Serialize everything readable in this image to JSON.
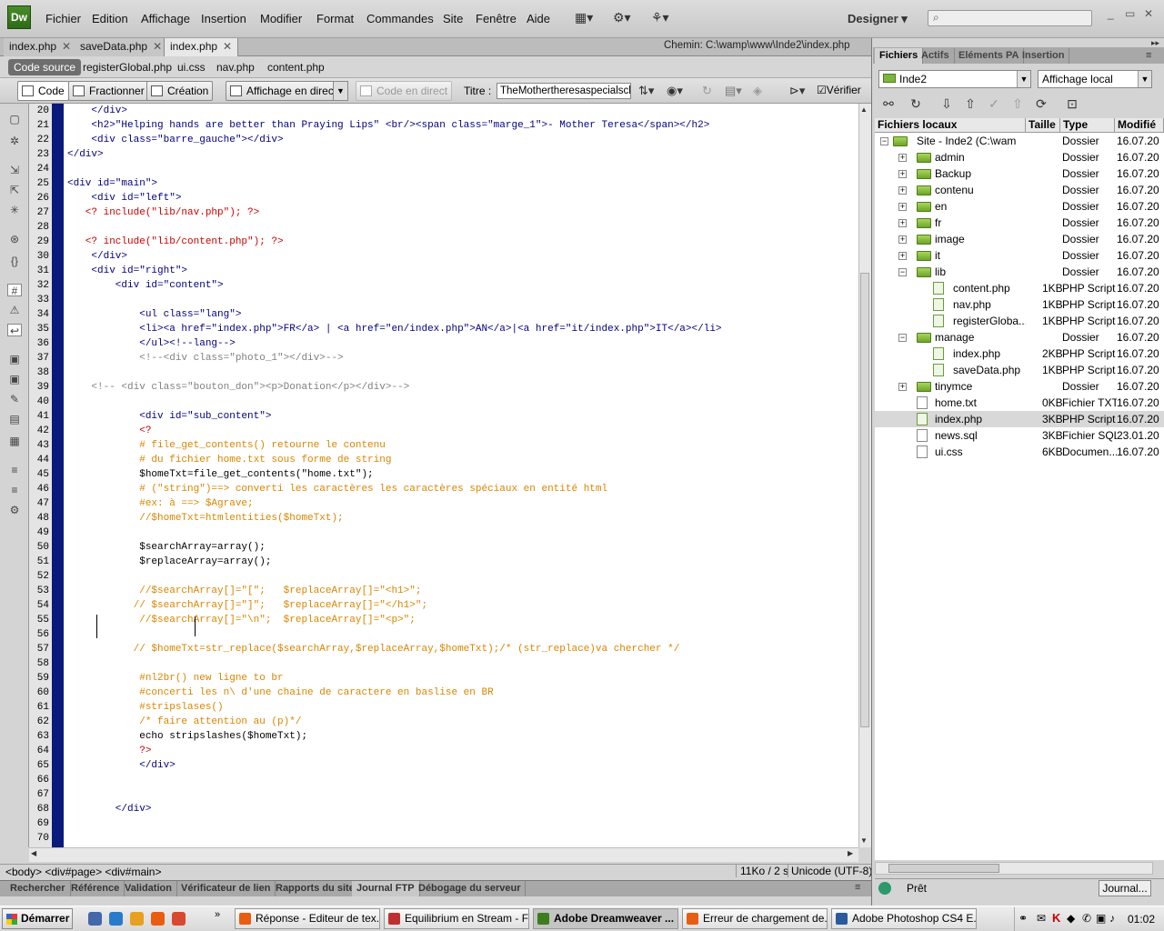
{
  "app": {
    "logo": "Dw",
    "menus": [
      "Fichier",
      "Edition",
      "Affichage",
      "Insertion",
      "Modifier",
      "Format",
      "Commandes",
      "Site",
      "Fenêtre",
      "Aide"
    ],
    "workspace": "Designer",
    "window_controls": [
      "_",
      "▭",
      "✕"
    ]
  },
  "tabs": [
    {
      "label": "index.php",
      "active": false
    },
    {
      "label": "saveData.php",
      "active": false
    },
    {
      "label": "index.php",
      "active": true
    }
  ],
  "chemin": "Chemin:  C:\\wamp\\www\\Inde2\\index.php",
  "related": {
    "current": "Code source",
    "files": [
      "registerGlobal.php",
      "ui.css",
      "nav.php",
      "content.php"
    ]
  },
  "doc_toolbar": {
    "code": "Code",
    "split": "Fractionner",
    "design": "Création",
    "live": "Affichage en direct",
    "live_code": "Code en direct",
    "titre_label": "Titre :",
    "titre_value": "TheMothertheresaspecialscho",
    "verify": "Vérifier"
  },
  "code": {
    "lines": [
      {
        "n": "20",
        "t": "    </div>",
        "c": "b"
      },
      {
        "n": "21",
        "t": "    <h2>\"Helping hands are better than Praying Lips\" <br/><span class=\"marge_1\">- Mother Teresa</span></h2>",
        "c": "b"
      },
      {
        "n": "22",
        "t": "    <div class=\"barre_gauche\"></div>",
        "c": "b"
      },
      {
        "n": "23",
        "t": "</div>",
        "c": "b"
      },
      {
        "n": "24",
        "t": "",
        "c": "b"
      },
      {
        "n": "25",
        "t": "<div id=\"main\">",
        "c": "b"
      },
      {
        "n": "26",
        "t": "    <div id=\"left\">",
        "c": "b"
      },
      {
        "n": "27",
        "t": "   <? include(\"lib/nav.php\"); ?>",
        "c": "r"
      },
      {
        "n": "28",
        "t": "",
        "c": "b"
      },
      {
        "n": "29",
        "t": "   <? include(\"lib/content.php\"); ?>",
        "c": "r"
      },
      {
        "n": "30",
        "t": "    </div>",
        "c": "b"
      },
      {
        "n": "31",
        "t": "    <div id=\"right\">",
        "c": "b"
      },
      {
        "n": "32",
        "t": "        <div id=\"content\">",
        "c": "b"
      },
      {
        "n": "33",
        "t": "",
        "c": "b"
      },
      {
        "n": "34",
        "t": "            <ul class=\"lang\">",
        "c": "b"
      },
      {
        "n": "35",
        "t": "            <li><a href=\"index.php\">FR</a> | <a href=\"en/index.php\">AN</a>|<a href=\"it/index.php\">IT</a></li>",
        "c": "b"
      },
      {
        "n": "36",
        "t": "            </ul><!--lang-->",
        "c": "b"
      },
      {
        "n": "37",
        "t": "            <!--<div class=\"photo_1\"></div>-->",
        "c": "g"
      },
      {
        "n": "38",
        "t": "",
        "c": "b"
      },
      {
        "n": "39",
        "t": "    <!-- <div class=\"bouton_don\"><p>Donation</p></div>-->",
        "c": "g"
      },
      {
        "n": "40",
        "t": "",
        "c": "b"
      },
      {
        "n": "41",
        "t": "            <div id=\"sub_content\">",
        "c": "b"
      },
      {
        "n": "42",
        "t": "            <?",
        "c": "r"
      },
      {
        "n": "43",
        "t": "            # file_get_contents() retourne le contenu",
        "c": "o"
      },
      {
        "n": "44",
        "t": "            # du fichier home.txt sous forme de string",
        "c": "o"
      },
      {
        "n": "45",
        "t": "            $homeTxt=file_get_contents(\"home.txt\");",
        "c": "k"
      },
      {
        "n": "46",
        "t": "            # (\"string\")==> converti les caractères les caractères spéciaux en entité html",
        "c": "o"
      },
      {
        "n": "47",
        "t": "            #ex: à ==> $Agrave;",
        "c": "o"
      },
      {
        "n": "48",
        "t": "            //$homeTxt=htmlentities($homeTxt);",
        "c": "o"
      },
      {
        "n": "49",
        "t": "",
        "c": "b"
      },
      {
        "n": "50",
        "t": "            $searchArray=array();",
        "c": "k"
      },
      {
        "n": "51",
        "t": "            $replaceArray=array();",
        "c": "k"
      },
      {
        "n": "52",
        "t": "",
        "c": "b"
      },
      {
        "n": "53",
        "t": "            //$searchArray[]=\"[\";   $replaceArray[]=\"<h1>\";",
        "c": "o"
      },
      {
        "n": "54",
        "t": "           // $searchArray[]=\"]\";   $replaceArray[]=\"</h1>\";",
        "c": "o"
      },
      {
        "n": "55",
        "t": "            //$searchArray[]=\"\\n\";  $replaceArray[]=\"<p>\";",
        "c": "o"
      },
      {
        "n": "56",
        "t": "",
        "c": "b"
      },
      {
        "n": "57",
        "t": "           // $homeTxt=str_replace($searchArray,$replaceArray,$homeTxt);/* (str_replace)va chercher */",
        "c": "o"
      },
      {
        "n": "58",
        "t": "",
        "c": "b"
      },
      {
        "n": "59",
        "t": "            #nl2br() new ligne to br",
        "c": "o"
      },
      {
        "n": "60",
        "t": "            #concerti les n\\ d'une chaine de caractere en baslise en BR",
        "c": "o"
      },
      {
        "n": "61",
        "t": "            #stripslases()",
        "c": "o"
      },
      {
        "n": "62",
        "t": "            /* faire attention au (p)*/",
        "c": "o"
      },
      {
        "n": "63",
        "t": "            echo stripslashes($homeTxt);",
        "c": "k"
      },
      {
        "n": "64",
        "t": "            ?>",
        "c": "r"
      },
      {
        "n": "65",
        "t": "            </div>",
        "c": "b"
      },
      {
        "n": "66",
        "t": "",
        "c": "b"
      },
      {
        "n": "67",
        "t": "",
        "c": "b"
      },
      {
        "n": "68",
        "t": "        </div>",
        "c": "b"
      },
      {
        "n": "69",
        "t": "",
        "c": "b"
      },
      {
        "n": "70",
        "t": "",
        "c": "b"
      }
    ]
  },
  "status": {
    "tag_selector": "<body> <div#page> <div#main>",
    "size": "11Ko / 2 s",
    "encoding": "Unicode (UTF-8)"
  },
  "bottom_tabs": [
    {
      "label": "Rechercher",
      "active": false
    },
    {
      "label": "Référence",
      "active": false
    },
    {
      "label": "Validation",
      "active": false
    },
    {
      "label": "Vérificateur de lien",
      "active": false
    },
    {
      "label": "Rapports du site",
      "active": false
    },
    {
      "label": "Journal FTP",
      "active": true
    },
    {
      "label": "Débogage du serveur",
      "active": false
    }
  ],
  "files_panel": {
    "tabs": [
      {
        "label": "Fichiers",
        "active": true
      },
      {
        "label": "Actifs",
        "active": false
      },
      {
        "label": "Eléments PA",
        "active": false
      },
      {
        "label": "Insertion",
        "active": false
      }
    ],
    "site": "Inde2",
    "view": "Affichage local",
    "headers": [
      "Fichiers locaux",
      "Taille",
      "Type",
      "Modifié"
    ],
    "rows": [
      {
        "name": "Site - Inde2 (C:\\wam...",
        "size": "",
        "type": "Dossier",
        "mod": "16.07.20",
        "kind": "folder",
        "level": 0,
        "exp": "−",
        "selected": false
      },
      {
        "name": "admin",
        "size": "",
        "type": "Dossier",
        "mod": "16.07.20",
        "kind": "folder",
        "level": 1,
        "exp": "+",
        "selected": false
      },
      {
        "name": "Backup",
        "size": "",
        "type": "Dossier",
        "mod": "16.07.20",
        "kind": "folder",
        "level": 1,
        "exp": "+",
        "selected": false
      },
      {
        "name": "contenu",
        "size": "",
        "type": "Dossier",
        "mod": "16.07.20",
        "kind": "folder",
        "level": 1,
        "exp": "+",
        "selected": false
      },
      {
        "name": "en",
        "size": "",
        "type": "Dossier",
        "mod": "16.07.20",
        "kind": "folder",
        "level": 1,
        "exp": "+",
        "selected": false
      },
      {
        "name": "fr",
        "size": "",
        "type": "Dossier",
        "mod": "16.07.20",
        "kind": "folder",
        "level": 1,
        "exp": "+",
        "selected": false
      },
      {
        "name": "image",
        "size": "",
        "type": "Dossier",
        "mod": "16.07.20",
        "kind": "folder",
        "level": 1,
        "exp": "+",
        "selected": false
      },
      {
        "name": "it",
        "size": "",
        "type": "Dossier",
        "mod": "16.07.20",
        "kind": "folder",
        "level": 1,
        "exp": "+",
        "selected": false
      },
      {
        "name": "lib",
        "size": "",
        "type": "Dossier",
        "mod": "16.07.20",
        "kind": "folder",
        "level": 1,
        "exp": "−",
        "selected": false
      },
      {
        "name": "content.php",
        "size": "1KB",
        "type": "PHP Script",
        "mod": "16.07.20",
        "kind": "php",
        "level": 2,
        "exp": "",
        "selected": false
      },
      {
        "name": "nav.php",
        "size": "1KB",
        "type": "PHP Script",
        "mod": "16.07.20",
        "kind": "php",
        "level": 2,
        "exp": "",
        "selected": false
      },
      {
        "name": "registerGloba...",
        "size": "1KB",
        "type": "PHP Script",
        "mod": "16.07.20",
        "kind": "php",
        "level": 2,
        "exp": "",
        "selected": false
      },
      {
        "name": "manage",
        "size": "",
        "type": "Dossier",
        "mod": "16.07.20",
        "kind": "folder",
        "level": 1,
        "exp": "−",
        "selected": false
      },
      {
        "name": "index.php",
        "size": "2KB",
        "type": "PHP Script",
        "mod": "16.07.20",
        "kind": "php",
        "level": 2,
        "exp": "",
        "selected": false
      },
      {
        "name": "saveData.php",
        "size": "1KB",
        "type": "PHP Script",
        "mod": "16.07.20",
        "kind": "php",
        "level": 2,
        "exp": "",
        "selected": false
      },
      {
        "name": "tinymce",
        "size": "",
        "type": "Dossier",
        "mod": "16.07.20",
        "kind": "folder",
        "level": 1,
        "exp": "+",
        "selected": false
      },
      {
        "name": "home.txt",
        "size": "0KB",
        "type": "Fichier TXT",
        "mod": "16.07.20",
        "kind": "file",
        "level": 1,
        "exp": "",
        "selected": false
      },
      {
        "name": "index.php",
        "size": "3KB",
        "type": "PHP Script",
        "mod": "16.07.20",
        "kind": "php",
        "level": 1,
        "exp": "",
        "selected": true
      },
      {
        "name": "news.sql",
        "size": "3KB",
        "type": "Fichier SQL",
        "mod": "23.01.20",
        "kind": "file",
        "level": 1,
        "exp": "",
        "selected": false
      },
      {
        "name": "ui.css",
        "size": "6KB",
        "type": "Documen...",
        "mod": "16.07.20",
        "kind": "file",
        "level": 1,
        "exp": "",
        "selected": false
      }
    ],
    "status": "Prêt",
    "journal": "Journal..."
  },
  "taskbar": {
    "start": "Démarrer",
    "tasks": [
      {
        "label": "Réponse - Editeur de tex...",
        "active": false
      },
      {
        "label": "Equilibrium en Stream - Fi...",
        "active": false
      },
      {
        "label": "Adobe Dreamweaver ...",
        "active": true
      },
      {
        "label": "Erreur de chargement de...",
        "active": false
      },
      {
        "label": "Adobe Photoshop CS4 E...",
        "active": false
      }
    ],
    "clock": "01:02"
  }
}
